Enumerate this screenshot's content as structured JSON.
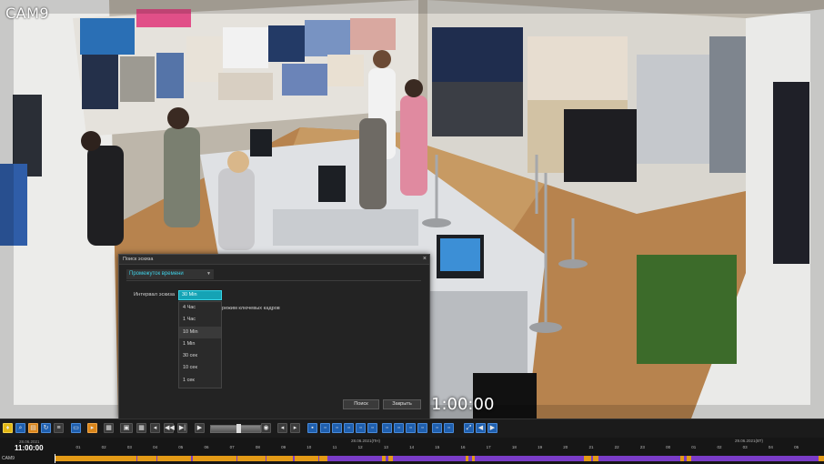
{
  "video": {
    "camera_label": "CAM9",
    "timecode": "1:00:00"
  },
  "dialog": {
    "title": "Поиск эскиза",
    "close_glyph": "×",
    "tab_label": "Промежуток времени",
    "interval_label": "Интервал эскиза",
    "selected_value": "30 Min",
    "keyframe_text": "режим ключевых кадров",
    "options": [
      "4 Час",
      "1 Час",
      "10 Min",
      "1 Min",
      "30 сек",
      "10 сек",
      "1 сек"
    ],
    "search_button": "Поиск",
    "close_button": "Закрыть"
  },
  "timeline": {
    "date_left": "28.06.2021",
    "current_time": "11:00:00",
    "date_mid": "28.06.2021(ПН)",
    "date_right": "29.06.2021(ВТ)",
    "camera": "CAM9",
    "hours": [
      "01",
      "02",
      "03",
      "04",
      "05",
      "06",
      "07",
      "08",
      "09",
      "10",
      "11",
      "12",
      "13",
      "14",
      "15",
      "16",
      "17",
      "18",
      "19",
      "20",
      "21",
      "22",
      "23",
      "00",
      "01",
      "02",
      "03",
      "04",
      "05"
    ]
  },
  "colors": {
    "accent": "#15a3b5",
    "timeline_record": "#e39a16",
    "timeline_motion": "#7a3cc8"
  }
}
